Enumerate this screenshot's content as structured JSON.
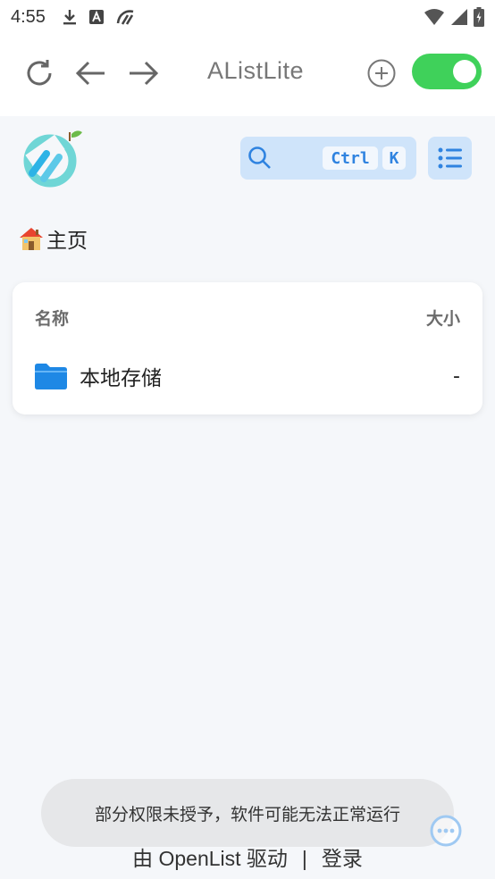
{
  "status_bar": {
    "time": "4:55",
    "icons": [
      "download-icon",
      "a-icon",
      "app-icon"
    ],
    "right_icons": [
      "wifi-icon",
      "signal-icon",
      "battery-icon"
    ]
  },
  "app_bar": {
    "title": "AListLite",
    "toggle_on": true,
    "accent_color": "#3fd15a"
  },
  "search": {
    "kbd_ctrl": "Ctrl",
    "kbd_k": "K"
  },
  "breadcrumb": {
    "home_label": "主页"
  },
  "file_list": {
    "header_name": "名称",
    "header_size": "大小",
    "rows": [
      {
        "name": "本地存储",
        "size": "-",
        "icon": "folder-icon"
      }
    ]
  },
  "toast": {
    "message": "部分权限未授予，软件可能无法正常运行"
  },
  "footer": {
    "powered_by": "由 OpenList 驱动",
    "separator": "|",
    "login": "登录"
  }
}
